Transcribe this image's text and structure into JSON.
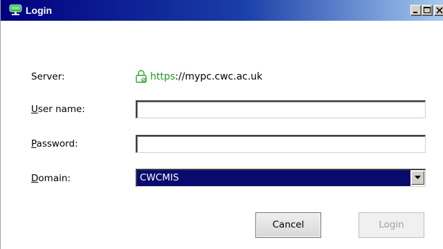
{
  "window": {
    "title": "Login",
    "controls": [
      "minimize",
      "maximize",
      "close"
    ]
  },
  "form": {
    "server_label": "Server:",
    "server_scheme": "https",
    "server_rest": "://mypc.cwc.ac.uk",
    "username": {
      "label_mnemonic": "U",
      "label_rest": "ser name:",
      "value": ""
    },
    "password": {
      "label_mnemonic": "P",
      "label_rest": "assword:",
      "value": ""
    },
    "domain": {
      "label_mnemonic": "D",
      "label_rest": "omain:",
      "selected": "CWCMIS"
    }
  },
  "buttons": {
    "cancel_label": "Cancel",
    "login_label": "Login",
    "login_enabled": false
  },
  "colors": {
    "titlebar_start": "#00007f",
    "titlebar_end": "#a6caf0",
    "https_green": "#1c9a1c",
    "selection": "#0a0a6e"
  },
  "icons": {
    "app": "green-monitor-icon",
    "lock": "lock-icon",
    "dropdown": "chevron-down-icon"
  }
}
